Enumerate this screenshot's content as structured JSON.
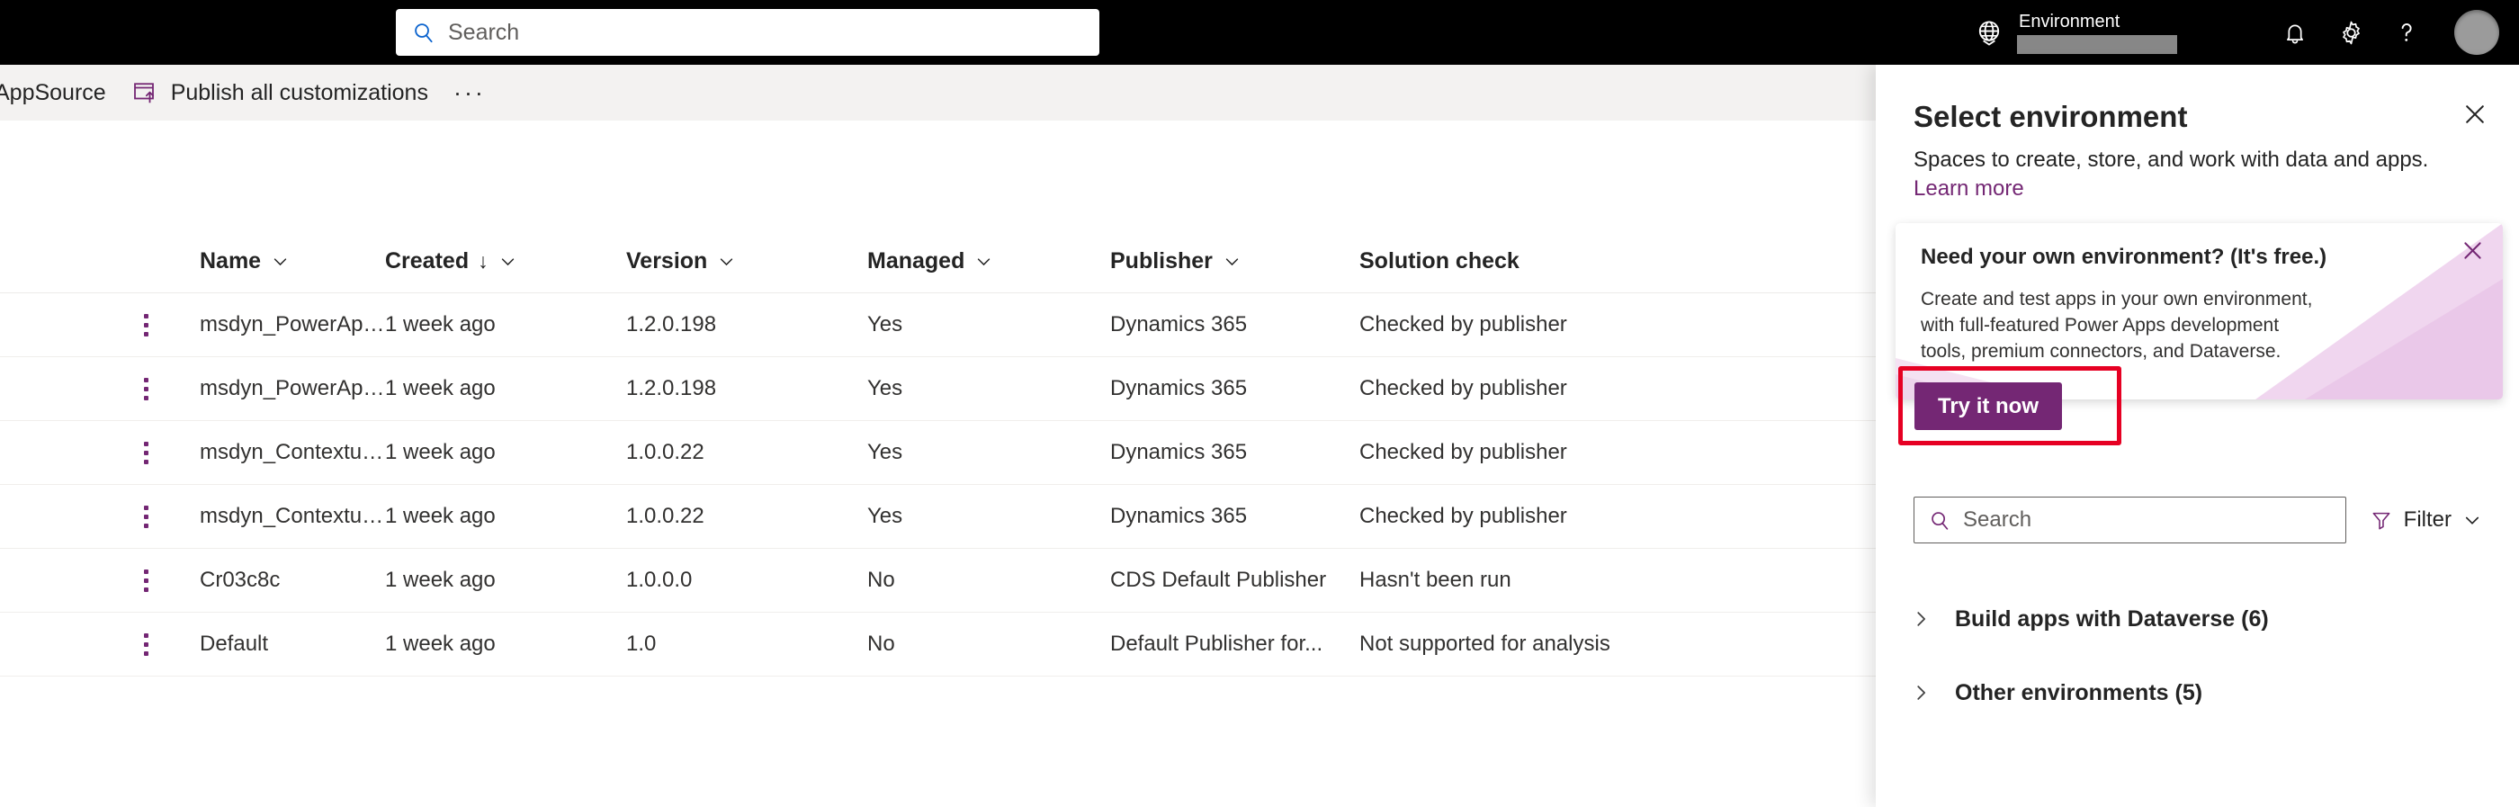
{
  "topbar": {
    "search_placeholder": "Search",
    "environment_label": "Environment",
    "environment_value": "",
    "icons": {
      "search": "search-icon",
      "globe": "globe-icon",
      "bell": "notifications-bell-icon",
      "gear": "settings-gear-icon",
      "help": "help-question-icon",
      "avatar": "user-avatar"
    }
  },
  "commandbar": {
    "appsource_label": "AppSource",
    "publish_label": "Publish all customizations",
    "more_label": "···"
  },
  "table": {
    "columns": [
      {
        "label": "Name",
        "sorted": false,
        "sort_dir": ""
      },
      {
        "label": "Created",
        "sorted": true,
        "sort_dir": "↓"
      },
      {
        "label": "Version",
        "sorted": false,
        "sort_dir": ""
      },
      {
        "label": "Managed",
        "sorted": false,
        "sort_dir": ""
      },
      {
        "label": "Publisher",
        "sorted": false,
        "sort_dir": ""
      },
      {
        "label": "Solution check",
        "sorted": false,
        "sort_dir": ""
      }
    ],
    "rows": [
      {
        "name": "msdyn_PowerAppsC...",
        "created": "1 week ago",
        "version": "1.2.0.198",
        "managed": "Yes",
        "publisher": "Dynamics 365",
        "solution_check": "Checked by publisher"
      },
      {
        "name": "msdyn_PowerAppsC...",
        "created": "1 week ago",
        "version": "1.2.0.198",
        "managed": "Yes",
        "publisher": "Dynamics 365",
        "solution_check": "Checked by publisher"
      },
      {
        "name": "msdyn_ContextualH...",
        "created": "1 week ago",
        "version": "1.0.0.22",
        "managed": "Yes",
        "publisher": "Dynamics 365",
        "solution_check": "Checked by publisher"
      },
      {
        "name": "msdyn_ContextualH...",
        "created": "1 week ago",
        "version": "1.0.0.22",
        "managed": "Yes",
        "publisher": "Dynamics 365",
        "solution_check": "Checked by publisher"
      },
      {
        "name": "Cr03c8c",
        "created": "1 week ago",
        "version": "1.0.0.0",
        "managed": "No",
        "publisher": "CDS Default Publisher",
        "solution_check": "Hasn't been run"
      },
      {
        "name": "Default",
        "created": "1 week ago",
        "version": "1.0",
        "managed": "No",
        "publisher": "Default Publisher for...",
        "solution_check": "Not supported for analysis"
      }
    ]
  },
  "panel": {
    "title": "Select environment",
    "subtitle": "Spaces to create, store, and work with data and apps.",
    "learn_more": "Learn more",
    "close_icon": "close-icon",
    "callout": {
      "title": "Need your own environment? (It's free.)",
      "body": "Create and test apps in your own environment, with full-featured Power Apps development tools, premium connectors, and Dataverse.",
      "cta_label": "Try it now",
      "close_icon": "close-icon"
    },
    "search_placeholder": "Search",
    "filter_label": "Filter",
    "groups": [
      {
        "label": "Build apps with Dataverse (6)"
      },
      {
        "label": "Other environments (5)"
      }
    ]
  },
  "colors": {
    "accent_purple": "#742774",
    "header_black": "#000000",
    "commandbar_gray": "#f3f2f1",
    "annotation_red": "#e60023",
    "callout_pink": "#e9c9e6"
  }
}
